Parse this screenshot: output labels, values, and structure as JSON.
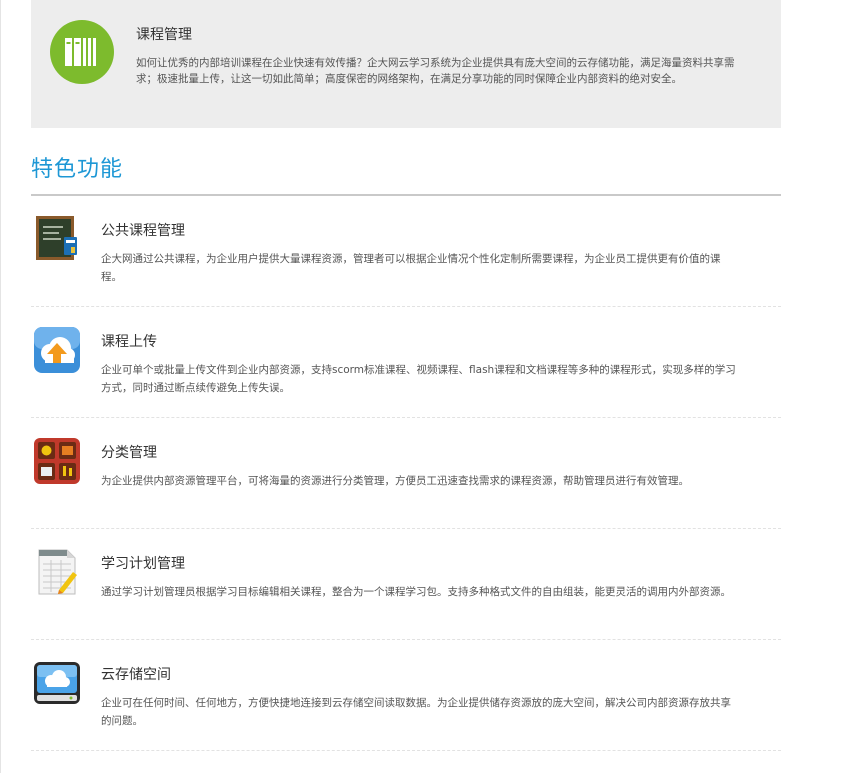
{
  "intro": {
    "icon": "bookshelf-icon",
    "icon_color": "#7dbb2d",
    "title": "课程管理",
    "description": "如何让优秀的内部培训课程在企业快速有效传播？企大网云学习系统为企业提供具有庞大空间的云存储功能，满足海量资料共享需求；极速批量上传，让这一切如此简单；高度保密的网络架构，在满足分享功能的同时保障企业内部资料的绝对安全。"
  },
  "section": {
    "title": "特色功能",
    "title_color": "#1d97d5"
  },
  "features": [
    {
      "icon": "blackboard-icon",
      "title": "公共课程管理",
      "description": "企大网通过公共课程，为企业用户提供大量课程资源，管理者可以根据企业情况个性化定制所需要课程，为企业员工提供更有价值的课程。"
    },
    {
      "icon": "cloud-upload-icon",
      "title": "课程上传",
      "description": "企业可单个或批量上传文件到企业内部资源，支持scorm标准课程、视频课程、flash课程和文档课程等多种的课程形式，实现多样的学习方式，同时通过断点续传避免上传失误。"
    },
    {
      "icon": "category-grid-icon",
      "title": "分类管理",
      "description": "为企业提供内部资源管理平台，可将海量的资源进行分类管理，方便员工迅速查找需求的课程资源，帮助管理员进行有效管理。"
    },
    {
      "icon": "study-plan-icon",
      "title": "学习计划管理",
      "description": "通过学习计划管理员根据学习目标编辑相关课程，整合为一个课程学习包。支持多种格式文件的自由组装，能更灵活的调用内外部资源。"
    },
    {
      "icon": "cloud-storage-icon",
      "title": "云存储空间",
      "description": "企业可在任何时间、任何地方，方便快捷地连接到云存储空间读取数据。为企业提供储存资源放的庞大空间，解决公司内部资源存放共享的问题。"
    }
  ]
}
